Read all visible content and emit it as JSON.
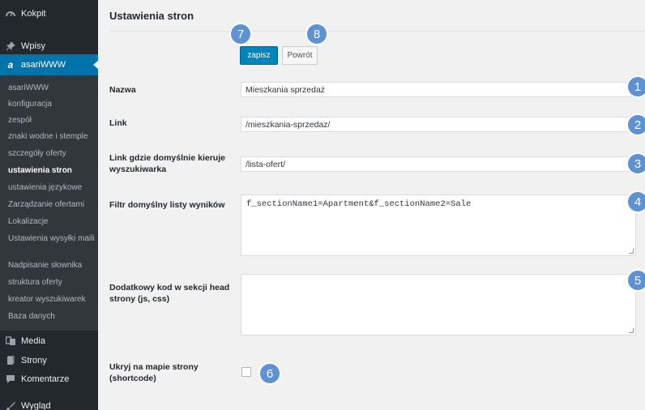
{
  "sidebar": {
    "top_items": [
      {
        "label": "Kokpit",
        "icon": "dashboard-icon"
      },
      {
        "label": "Wpisy",
        "icon": "pin-icon"
      },
      {
        "label": "asariWWW",
        "icon": "asari-logo-icon"
      }
    ],
    "submenu": [
      "asariWWW",
      "konfiguracja",
      "zespół",
      "znaki wodne i stemple",
      "szczegóły oferty",
      "ustawienia stron",
      "ustawienia językowe",
      "Zarządzanie ofertami",
      "Lokalizacje",
      "Ustawienia wysyłki maili",
      "Nadpisanie słownika",
      "struktura oferty",
      "kreator wyszukiwarek",
      "Baza danych"
    ],
    "active_submenu": "ustawienia stron",
    "bottom_items": [
      {
        "label": "Media",
        "icon": "media-icon"
      },
      {
        "label": "Strony",
        "icon": "pages-icon"
      },
      {
        "label": "Komentarze",
        "icon": "comments-icon"
      },
      {
        "label": "Wygląd",
        "icon": "appearance-icon"
      }
    ]
  },
  "page": {
    "title": "Ustawienia stron",
    "buttons": {
      "save": "zapisz",
      "back": "Powrót"
    },
    "fields": [
      {
        "label": "Nazwa",
        "value": "Mieszkania sprzedaż"
      },
      {
        "label": "Link",
        "value": "/mieszkania-sprzedaz/"
      },
      {
        "label": "Link gdzie domyślnie kieruje wyszukiwarka",
        "value": "/lista-ofert/"
      },
      {
        "label": "Filtr domyślny listy wyników",
        "value": "f_sectionName1=Apartment&f_sectionName2=Sale"
      },
      {
        "label": "Dodatkowy kod w sekcji head strony (js, css)",
        "value": ""
      },
      {
        "label": "Ukryj na mapie strony (shortcode)",
        "checked": false
      }
    ]
  },
  "badges": [
    "1",
    "2",
    "3",
    "4",
    "5",
    "6",
    "7",
    "8"
  ],
  "colors": {
    "accent": "#0073aa",
    "primary_button": "#0085ba",
    "badge": "#5e92d2",
    "sidebar": "#23282d"
  }
}
